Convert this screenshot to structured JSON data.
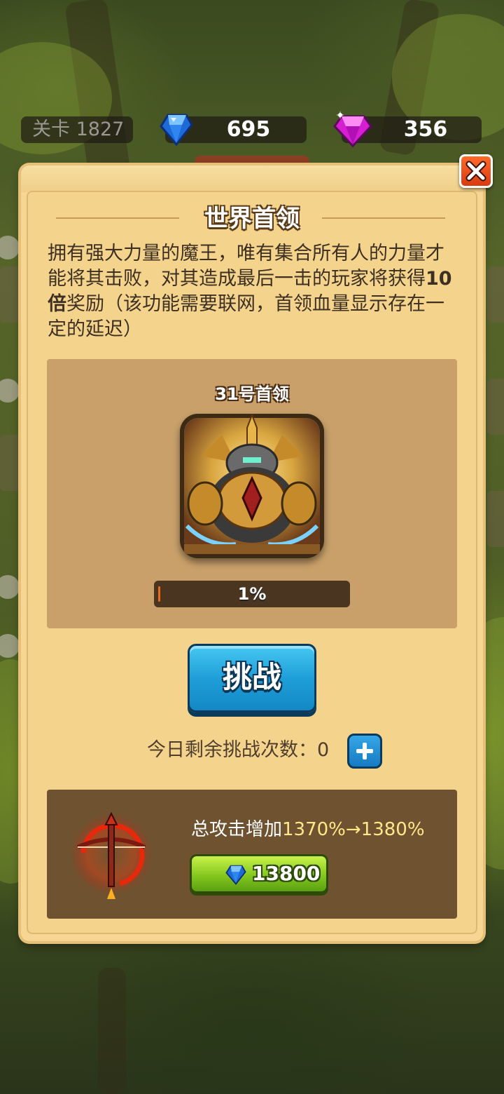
{
  "hud": {
    "level_label": "关卡 1827",
    "sapphire_count": "695",
    "gem_count": "356"
  },
  "panel": {
    "title": "世界首领",
    "description_part1": "拥有强大力量的魔王，唯有集合所有人的力量才能将其击败，对其造成最后一击的玩家将获得",
    "description_bold": "10倍",
    "description_part2": "奖励（该功能需要联网，首领血量显示存在一定的延迟）"
  },
  "boss": {
    "name": "31号首领",
    "progress_text": "1%",
    "progress": 0.01
  },
  "challenge": {
    "button_label": "挑战",
    "remaining_label": "今日剩余挑战次数：",
    "remaining_count": "0"
  },
  "upgrade": {
    "label": "总攻击增加",
    "values": "1370%→1380%",
    "price": "13800"
  },
  "icons": {
    "sapphire": "blue-sapphire-icon",
    "gem": "pink-gem-icon",
    "close": "close-icon",
    "plus": "plus-icon",
    "weapon": "crossbow-icon"
  }
}
